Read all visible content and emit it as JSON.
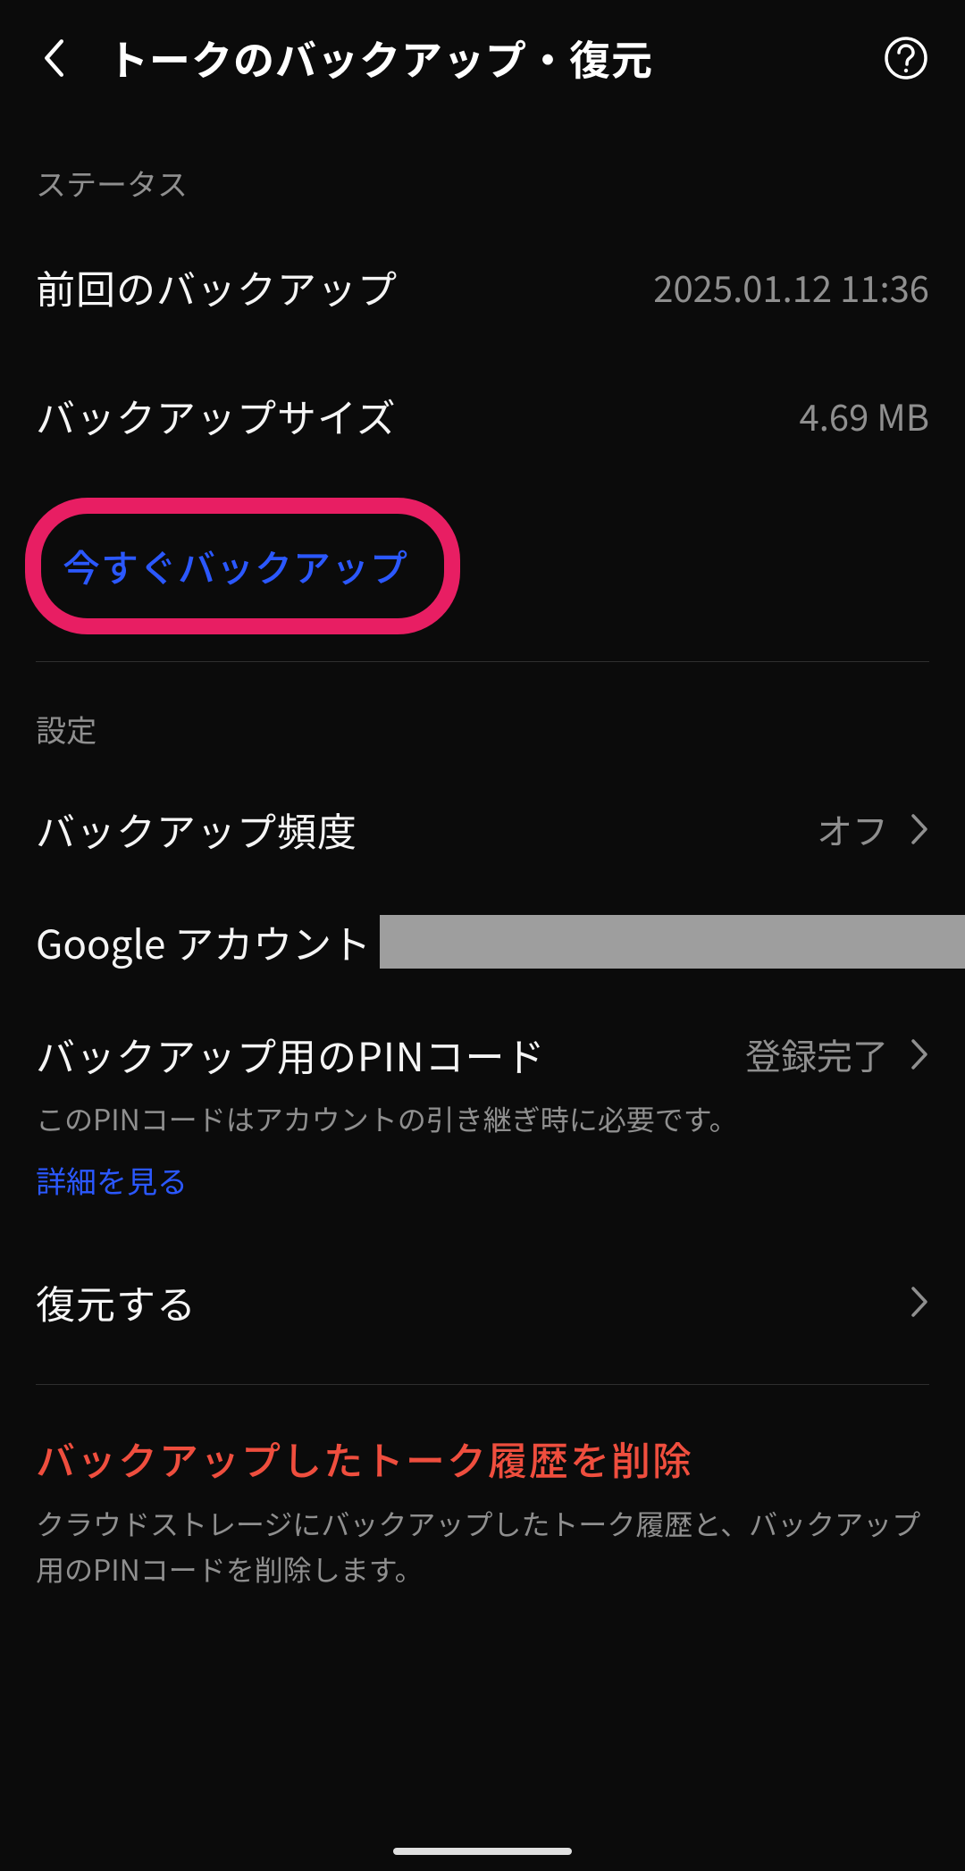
{
  "header": {
    "title": "トークのバックアップ・復元"
  },
  "status": {
    "section_label": "ステータス",
    "last_backup_label": "前回のバックアップ",
    "last_backup_value": "2025.01.12 11:36",
    "size_label": "バックアップサイズ",
    "size_value": "4.69 MB",
    "backup_now_label": "今すぐバックアップ"
  },
  "settings": {
    "section_label": "設定",
    "frequency_label": "バックアップ頻度",
    "frequency_value": "オフ",
    "google_account_label": "Google アカウント",
    "pin_label": "バックアップ用のPINコード",
    "pin_value": "登録完了",
    "pin_desc": "このPINコードはアカウントの引き継ぎ時に必要です。",
    "detail_link_label": "詳細を見る",
    "restore_label": "復元する"
  },
  "danger": {
    "title": "バックアップしたトーク履歴を削除",
    "desc": "クラウドストレージにバックアップしたトーク履歴と、バックアップ用のPINコードを削除します。"
  }
}
